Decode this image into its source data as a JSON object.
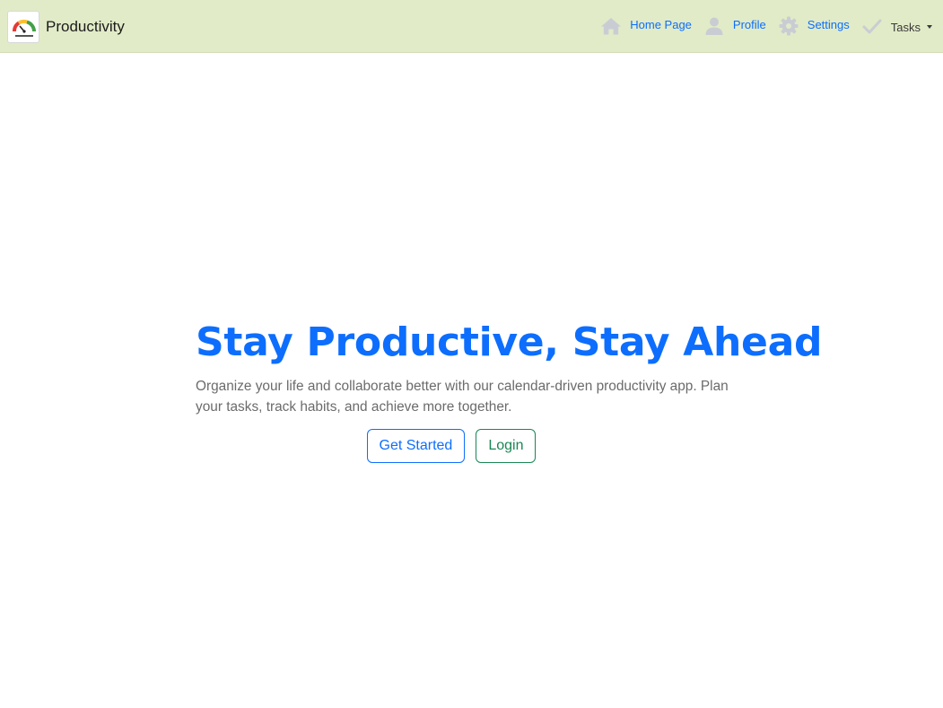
{
  "navbar": {
    "brand": {
      "name": "Productivity",
      "logo_icon": "speedometer-logo-icon"
    },
    "links": [
      {
        "label": "Home Page",
        "icon": "home-icon"
      },
      {
        "label": "Profile",
        "icon": "user-icon"
      },
      {
        "label": "Settings",
        "icon": "gear-icon"
      },
      {
        "label": "Tasks",
        "icon": "check-icon",
        "dropdown": true
      }
    ]
  },
  "hero": {
    "title": "Stay Productive, Stay Ahead",
    "text": "Organize your life and collaborate better with our calendar-driven productivity app. Plan your tasks, track habits, and achieve more together.",
    "primary_button": "Get Started",
    "secondary_button": "Login"
  },
  "colors": {
    "navbar_bg": "#e1ebc7",
    "primary": "#0d6efd",
    "success": "#198754",
    "muted_icon": "#c9cdd3"
  }
}
